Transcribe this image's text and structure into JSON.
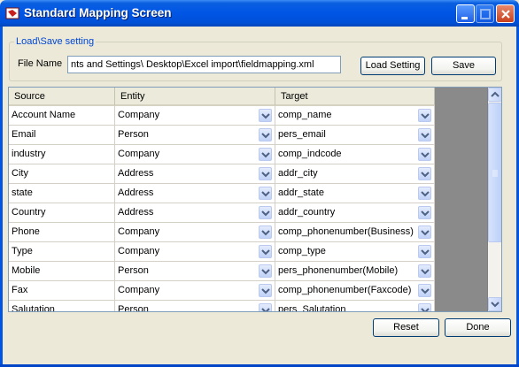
{
  "window": {
    "title": "Standard Mapping Screen"
  },
  "load_save": {
    "legend": "Load\\Save setting",
    "file_label": "File Name",
    "file_value": "nts and Settings\\ Desktop\\Excel import\\fieldmapping.xml",
    "load_button": "Load Setting",
    "save_button": "Save"
  },
  "grid": {
    "columns": [
      "Source",
      "Entity",
      "Target"
    ],
    "rows": [
      {
        "source": "Account Name",
        "entity": "Company",
        "target": "comp_name"
      },
      {
        "source": "Email",
        "entity": "Person",
        "target": "pers_email"
      },
      {
        "source": "industry",
        "entity": "Company",
        "target": "comp_indcode"
      },
      {
        "source": "City",
        "entity": "Address",
        "target": "addr_city"
      },
      {
        "source": "state",
        "entity": "Address",
        "target": "addr_state"
      },
      {
        "source": "Country",
        "entity": "Address",
        "target": "addr_country"
      },
      {
        "source": "Phone",
        "entity": "Company",
        "target": "comp_phonenumber(Business)"
      },
      {
        "source": "Type",
        "entity": "Company",
        "target": "comp_type"
      },
      {
        "source": "Mobile",
        "entity": "Person",
        "target": "pers_phonenumber(Mobile)"
      },
      {
        "source": "Fax",
        "entity": "Company",
        "target": "comp_phonenumber(Faxcode)"
      },
      {
        "source": "Salutation",
        "entity": "Person",
        "target": "pers_Salutation"
      }
    ]
  },
  "footer": {
    "reset_button": "Reset",
    "done_button": "Done"
  },
  "colors": {
    "title_bar": "#0055e5",
    "legend_text": "#0046d5",
    "window_bg": "#ece9d8"
  }
}
